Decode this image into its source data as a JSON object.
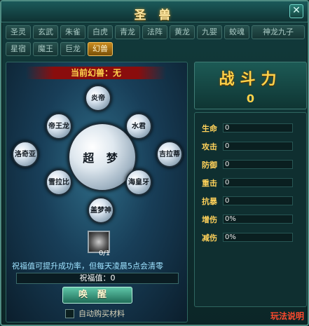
{
  "window": {
    "title": "圣 兽"
  },
  "tabs": [
    {
      "label": "圣灵"
    },
    {
      "label": "玄武"
    },
    {
      "label": "朱雀"
    },
    {
      "label": "白虎"
    },
    {
      "label": "青龙"
    },
    {
      "label": "法阵"
    },
    {
      "label": "黄龙"
    },
    {
      "label": "九婴"
    },
    {
      "label": "蛟魂"
    },
    {
      "label": "神龙九子"
    },
    {
      "label": "星宿"
    },
    {
      "label": "魔王"
    },
    {
      "label": "巨龙"
    },
    {
      "label": "幻兽"
    }
  ],
  "active_tab": "幻兽",
  "left": {
    "current_label": "当前幻兽：无",
    "center_orb": "超 梦",
    "orbs": [
      {
        "label": "炎帝"
      },
      {
        "label": "水君"
      },
      {
        "label": "吉拉蒂"
      },
      {
        "label": "海皇牙"
      },
      {
        "label": "盖梦神"
      },
      {
        "label": "雪拉比"
      },
      {
        "label": "洛奇亚"
      },
      {
        "label": "帝王龙"
      }
    ],
    "material_count": "0/1",
    "hint": "祝福值可提升成功率，但每天凌晨5点会清零",
    "bless_value": "祝福值：0",
    "awaken_label": "唤醒",
    "auto_buy_label": "自动购买材料"
  },
  "power": {
    "title": "战斗力",
    "value": "0"
  },
  "stats": [
    {
      "name": "生命",
      "value": "0"
    },
    {
      "name": "攻击",
      "value": "0"
    },
    {
      "name": "防御",
      "value": "0"
    },
    {
      "name": "重击",
      "value": "0"
    },
    {
      "name": "抗暴",
      "value": "0"
    },
    {
      "name": "增伤",
      "value": "0%"
    },
    {
      "name": "减伤",
      "value": "0%"
    }
  ],
  "rules_link": "玩法说明",
  "colors": {
    "gold": "#ffd24a",
    "active_tab": "#c98b1f",
    "banner_red": "#8a0d0d",
    "rules_red": "#ff4a2e"
  }
}
